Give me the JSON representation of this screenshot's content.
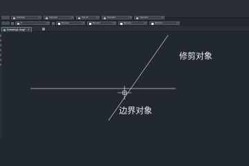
{
  "toolbar": {
    "row1_items": [
      {
        "text": "Standard",
        "swatch": "#b0b0b0"
      },
      {
        "text": "Standard",
        "swatch": "#b0b0b0"
      },
      {
        "text": "ISO-25",
        "swatch": "#b0b0b0"
      },
      {
        "text": "Standard",
        "swatch": "#b0b0b0"
      },
      {
        "text": "Standard",
        "swatch": "#b0b0b0"
      }
    ],
    "row2_items": [
      {
        "text": "0",
        "swatch": "#e8c040"
      },
      {
        "text": "ByLayer",
        "swatch": "#ffffff"
      },
      {
        "text": "ByLayer",
        "swatch": "#ffffff"
      },
      {
        "text": "ByLayer",
        "swatch": "#ffffff"
      },
      {
        "text": "ByColor",
        "swatch": "#ffffff"
      }
    ]
  },
  "tabs": {
    "active_label": "Drawing1.dwg*",
    "close_symbol": "×"
  },
  "drawing": {
    "annotation_trim": "修剪对象",
    "annotation_boundary": "边界对象",
    "line_color": "#c8ccd2",
    "background_color": "#212830"
  }
}
